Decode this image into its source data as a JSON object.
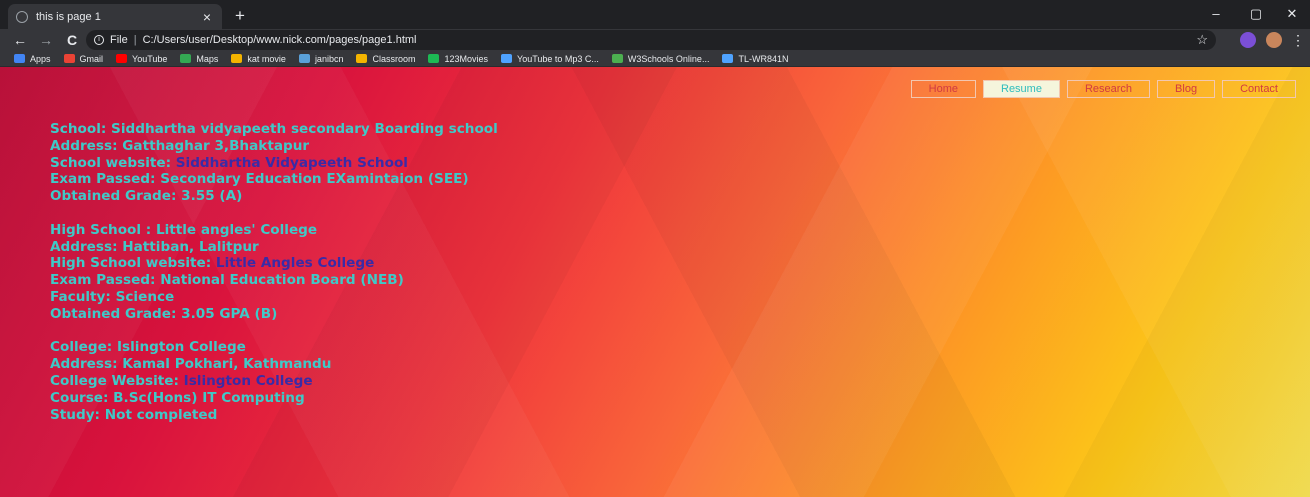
{
  "browser": {
    "tab_title": "this is page 1",
    "tab_close": "×",
    "new_tab": "+",
    "minimize": "–",
    "maximize": "▢",
    "close_window": "✕",
    "back": "←",
    "forward": "→",
    "reload": "C",
    "file_label": "File",
    "separator": "|",
    "url": "C:/Users/user/Desktop/www.nick.com/pages/page1.html",
    "star": "☆",
    "menu": "⋮"
  },
  "bookmarks": [
    {
      "label": "Apps",
      "color": "#4285f4"
    },
    {
      "label": "Gmail",
      "color": "#ea4335"
    },
    {
      "label": "YouTube",
      "color": "#ff0000"
    },
    {
      "label": "Maps",
      "color": "#34a853"
    },
    {
      "label": "kat movie",
      "color": "#f4b400"
    },
    {
      "label": "janibcn",
      "color": "#5aa0d8"
    },
    {
      "label": "Classroom",
      "color": "#f4b400"
    },
    {
      "label": "123Movies",
      "color": "#1db954"
    },
    {
      "label": "YouTube to Mp3 C...",
      "color": "#4fa3ff"
    },
    {
      "label": "W3Schools Online...",
      "color": "#4caf50"
    },
    {
      "label": "TL-WR841N",
      "color": "#4fa3ff"
    }
  ],
  "nav": {
    "home": "Home",
    "resume": "Resume",
    "research": "Research",
    "blog": "Blog",
    "contact": "Contact"
  },
  "school": {
    "name": "School: Siddhartha vidyapeeth secondary Boarding school",
    "address": "Address: Gatthaghar 3,Bhaktapur",
    "website_label": "School website: ",
    "website_link": "Siddhartha Vidyapeeth School",
    "exam": "Exam Passed: Secondary Education EXamintaion (SEE)",
    "grade": "Obtained Grade: 3.55 (A)"
  },
  "high_school": {
    "name": "High School : Little angles' College",
    "address": "Address: Hattiban, Lalitpur",
    "website_label": "High School website: ",
    "website_link": "Little Angles College",
    "exam": "Exam Passed: National Education Board (NEB)",
    "faculty": "Faculty: Science",
    "grade": "Obtained Grade: 3.05 GPA (B)"
  },
  "college": {
    "name": "College: Islington College",
    "address": "Address: Kamal Pokhari, Kathmandu",
    "website_label": "College Website: ",
    "website_link": "Islington College",
    "course": "Course: B.Sc(Hons) IT Computing",
    "study": "Study: Not completed"
  }
}
